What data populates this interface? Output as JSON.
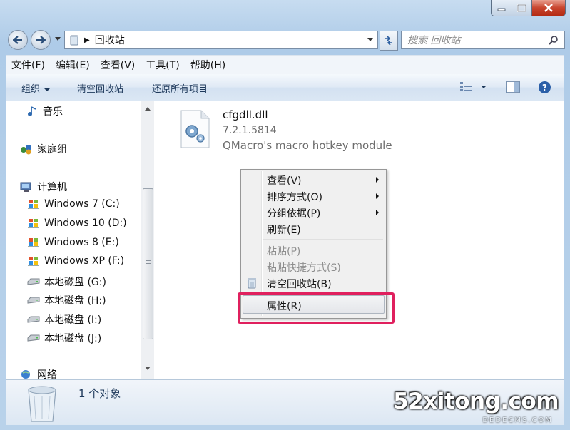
{
  "window": {
    "caption_buttons": [
      "minimize-icon",
      "maximize-icon",
      "close-icon"
    ]
  },
  "address": {
    "path": "回收站",
    "search_placeholder": "搜索 回收站"
  },
  "menubar": [
    "文件(F)",
    "编辑(E)",
    "查看(V)",
    "工具(T)",
    "帮助(H)"
  ],
  "toolbar": {
    "organize": "组织",
    "empty_bin": "清空回收站",
    "restore_all": "还原所有项目"
  },
  "nav": {
    "music": "音乐",
    "homegroup": "家庭组",
    "computer": "计算机",
    "drives": [
      "Windows 7 (C:)",
      "Windows 10 (D:)",
      "Windows 8 (E:)",
      "Windows XP (F:)",
      "本地磁盘 (G:)",
      "本地磁盘 (H:)",
      "本地磁盘 (I:)",
      "本地磁盘 (J:)"
    ],
    "network": "网络"
  },
  "file": {
    "name": "cfgdll.dll",
    "version": "7.2.1.5814",
    "description": "QMacro's macro hotkey module"
  },
  "context_menu": {
    "view": "查看(V)",
    "sort_by": "排序方式(O)",
    "group_by": "分组依据(P)",
    "refresh": "刷新(E)",
    "paste": "粘贴(P)",
    "paste_shortcut": "粘贴快捷方式(S)",
    "empty_bin": "清空回收站(B)",
    "properties": "属性(R)"
  },
  "details": {
    "count": "1 个对象"
  },
  "watermark": {
    "main": "52xitong.com",
    "sub": "DEDECMS.COM"
  },
  "colors": {
    "highlight_box": "#e0205e",
    "link_text": "#1e395b"
  }
}
